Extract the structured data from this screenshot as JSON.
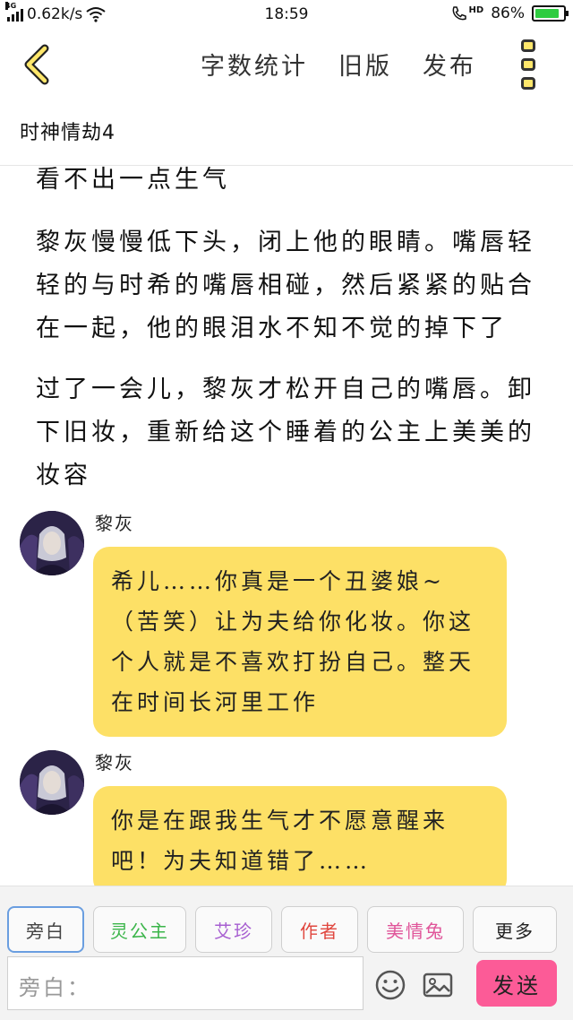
{
  "status_bar": {
    "network_tag": "4G",
    "speed": "0.62k/s",
    "time": "18:59",
    "hd_tag": "HD",
    "battery_percent": "86%",
    "battery_level": 0.86
  },
  "toolbar": {
    "word_count": "字数统计",
    "old_version": "旧版",
    "publish": "发布"
  },
  "doc": {
    "title": "时神情劫4"
  },
  "paragraphs": [
    "看不出一点生气",
    "黎灰慢慢低下头，闭上他的眼睛。嘴唇轻轻的与时希的嘴唇相碰，然后紧紧的贴合在一起，他的眼泪水不知不觉的掉下了",
    "过了一会儿，黎灰才松开自己的嘴唇。卸下旧妆，重新给这个睡着的公主上美美的妆容"
  ],
  "messages": [
    {
      "speaker": "黎灰",
      "text": "希儿……你真是一个丑婆娘~（苦笑）让为夫给你化妆。你这个人就是不喜欢打扮自己。整天在时间长河里工作"
    },
    {
      "speaker": "黎灰",
      "text": "你是在跟我生气才不愿意醒来吧！为夫知道错了……"
    }
  ],
  "roles": [
    {
      "label": "旁白",
      "color": "#444444",
      "active": true
    },
    {
      "label": "灵公主",
      "color": "#3bb54a",
      "active": false
    },
    {
      "label": "艾珍",
      "color": "#a75fd1",
      "active": false
    },
    {
      "label": "作者",
      "color": "#e0473f",
      "active": false
    },
    {
      "label": "美情兔",
      "color": "#e0559a",
      "active": false
    },
    {
      "label": "更多",
      "color": "#444444",
      "active": false
    }
  ],
  "input": {
    "placeholder": "旁白："
  },
  "send_label": "发送",
  "colors": {
    "bubble": "#fde066",
    "send": "#fc5b97",
    "accent_yellow": "#ffe76b"
  }
}
